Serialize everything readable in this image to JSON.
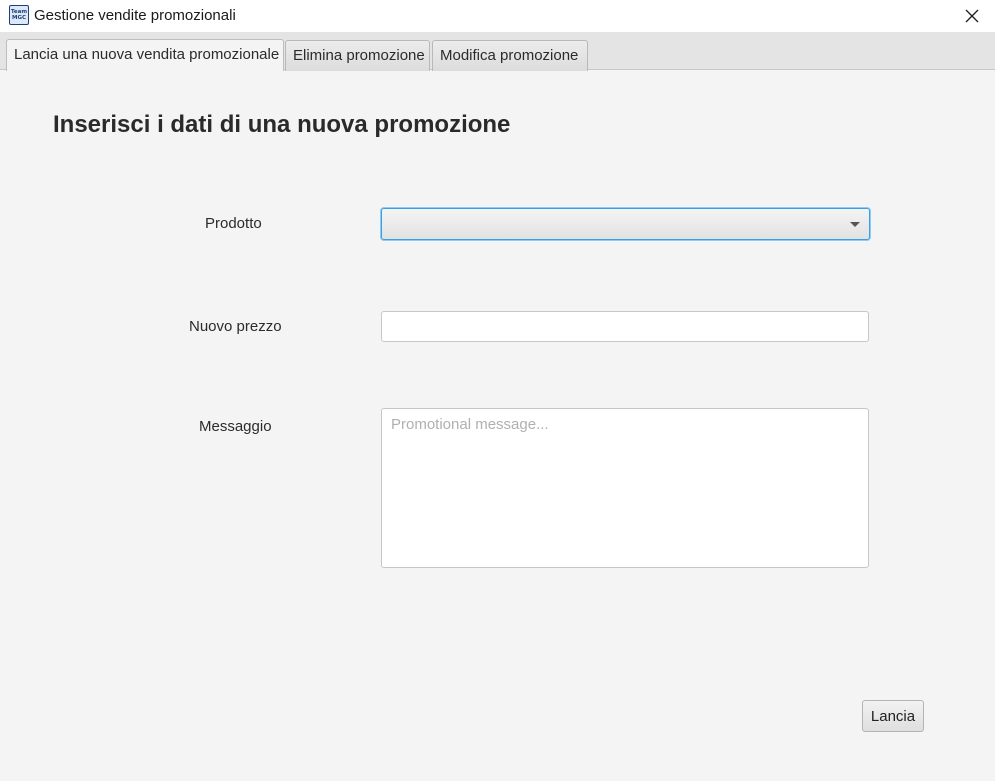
{
  "window": {
    "title": "Gestione vendite promozionali",
    "icon_text_top": "Team",
    "icon_text_bottom": "MGC"
  },
  "tabs": [
    {
      "label": "Lancia una nuova vendita promozionale",
      "active": true
    },
    {
      "label": "Elimina promozione",
      "active": false
    },
    {
      "label": "Modifica promozione",
      "active": false
    }
  ],
  "form": {
    "heading": "Inserisci i dati di una nuova promozione",
    "product_label": "Prodotto",
    "product_value": "",
    "price_label": "Nuovo prezzo",
    "price_value": "",
    "message_label": "Messaggio",
    "message_placeholder": "Promotional message...",
    "message_value": "",
    "submit_label": "Lancia"
  },
  "colors": {
    "focus_border": "#3a9fe0",
    "background": "#f4f4f4"
  }
}
